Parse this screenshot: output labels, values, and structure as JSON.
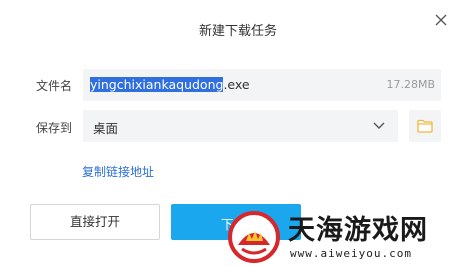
{
  "dialog": {
    "title": "新建下载任务"
  },
  "file": {
    "label": "文件名",
    "name_selected": "yingchixiankaqudong",
    "name_rest": ".exe",
    "size": "17.28MB"
  },
  "save": {
    "label": "保存到",
    "path": "桌面"
  },
  "links": {
    "copy_link": "复制链接地址"
  },
  "buttons": {
    "open_directly": "直接打开",
    "download": "下"
  },
  "watermark": {
    "title": "天海游戏网",
    "url": "www.aiweiyou.com"
  },
  "colors": {
    "accent": "#1aa7ee",
    "link": "#2b6fd6",
    "selection": "#2f6fe0",
    "folder": "#f0b83a"
  }
}
